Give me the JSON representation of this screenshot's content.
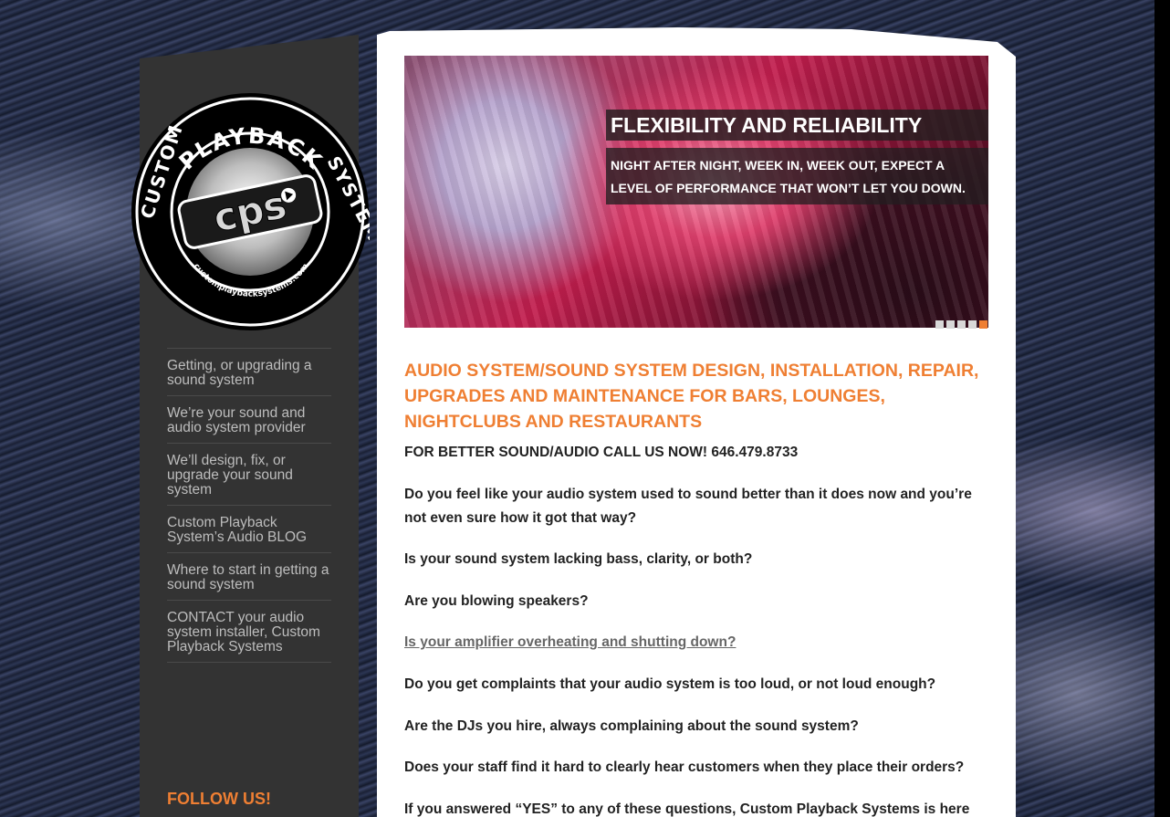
{
  "logo": {
    "ring_text_top": "PLAYBACK",
    "ring_text_left": "CUSTOM",
    "ring_text_right": "SYSTEMS",
    "ring_text_bottom": "customplaybacksystems.com",
    "monogram": "cps"
  },
  "sidebar": {
    "items": [
      {
        "label": "Getting, or upgrading a sound system"
      },
      {
        "label": "We’re your sound and audio system provider"
      },
      {
        "label": "We’ll design, fix, or upgrade your sound system"
      },
      {
        "label": "Custom Playback System’s Audio BLOG"
      },
      {
        "label": "Where to start in getting a sound system"
      },
      {
        "label": "CONTACT your audio system installer, Custom Playback Systems"
      }
    ],
    "follow_label": "FOLLOW US!"
  },
  "slider": {
    "title": "FLEXIBILITY AND RELIABILITY",
    "text": "NIGHT AFTER NIGHT, WEEK IN, WEEK OUT, EXPECT A LEVEL OF PERFORMANCE THAT WON’T LET YOU DOWN.",
    "slide_count": 5,
    "active_slide": 5
  },
  "content": {
    "headline": "AUDIO SYSTEM/SOUND SYSTEM DESIGN, INSTALLATION, REPAIR, UPGRADES AND MAINTENANCE FOR BARS, LOUNGES, NIGHTCLUBS AND RESTAURANTS",
    "callout": "FOR BETTER SOUND/AUDIO CALL US NOW! 646.479.8733",
    "questions": [
      "Do you feel like your audio system used to sound better than it does now and you’re not even sure how it got that way?",
      "Is your sound system lacking bass, clarity, or both?",
      "Are you blowing speakers?",
      "Is your amplifier overheating and shutting down?",
      "Do you get complaints that your audio system is too loud, or not loud enough?",
      "Are the DJs you hire, always complaining about the sound system?",
      "Does your staff find it hard to clearly hear customers when they place their orders?",
      "If you answered “YES” to any of these questions, Custom Playback Systems is here"
    ]
  },
  "colors": {
    "accent": "#ef7f33",
    "sidebar_bg": "#333333",
    "nav_text": "#bdbdbd"
  }
}
